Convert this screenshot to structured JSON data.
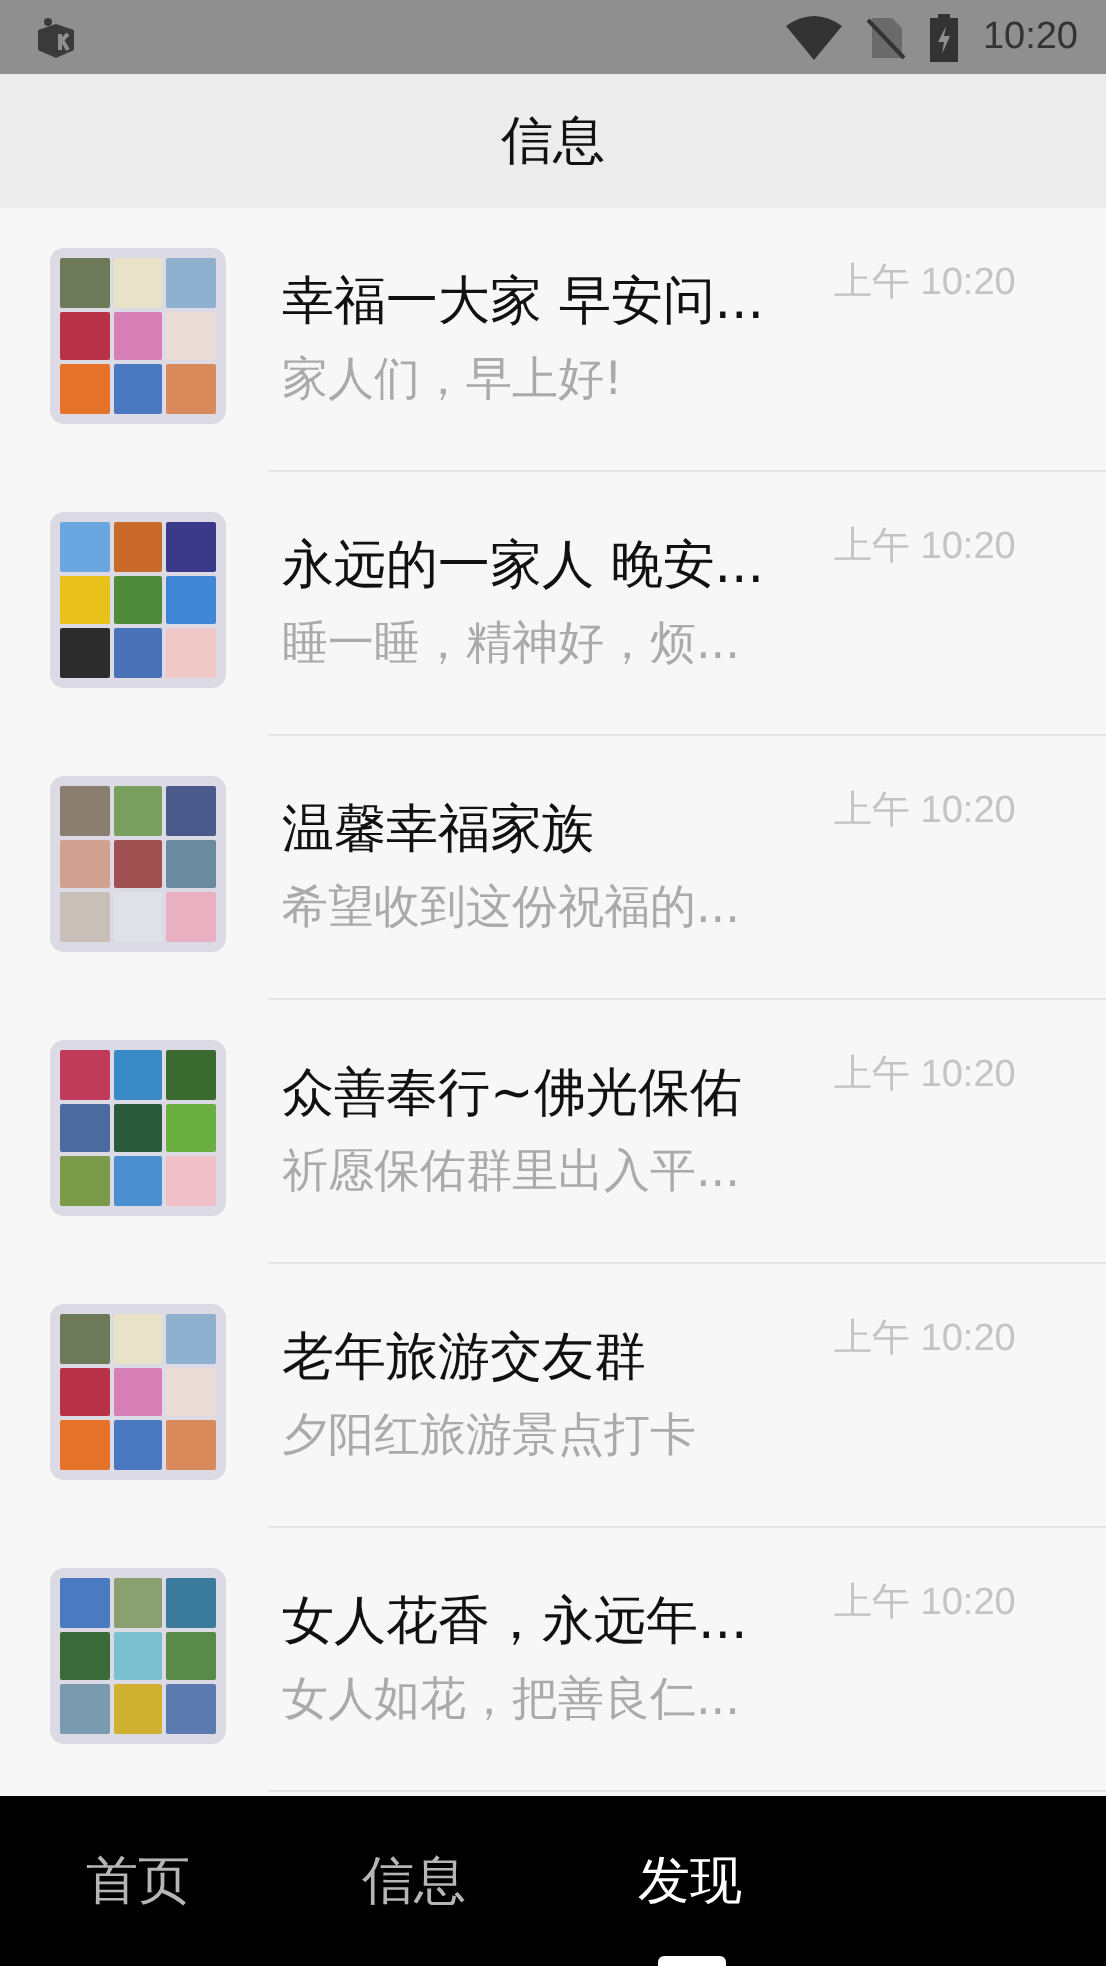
{
  "status_bar": {
    "time": "10:20"
  },
  "header": {
    "title": "信息"
  },
  "chats": [
    {
      "name": "幸福一大家 早安问...",
      "preview": "家人们，早上好!",
      "time": "上午 10:20"
    },
    {
      "name": "永远的一家人 晚安...",
      "preview": "睡一睡，精神好，烦...",
      "time": "上午 10:20"
    },
    {
      "name": "温馨幸福家族",
      "preview": "希望收到这份祝福的...",
      "time": "上午 10:20"
    },
    {
      "name": "众善奉行~佛光保佑",
      "preview": "祈愿保佑群里出入平...",
      "time": "上午 10:20"
    },
    {
      "name": "老年旅游交友群",
      "preview": "夕阳红旅游景点打卡",
      "time": "上午 10:20"
    },
    {
      "name": "女人花香，永远年...",
      "preview": "女人如花，把善良仁...",
      "time": "上午 10:20"
    }
  ],
  "tab_bar": [
    {
      "label": "首页",
      "selected": false
    },
    {
      "label": "信息",
      "selected": false
    },
    {
      "label": "发现",
      "selected": true
    }
  ]
}
